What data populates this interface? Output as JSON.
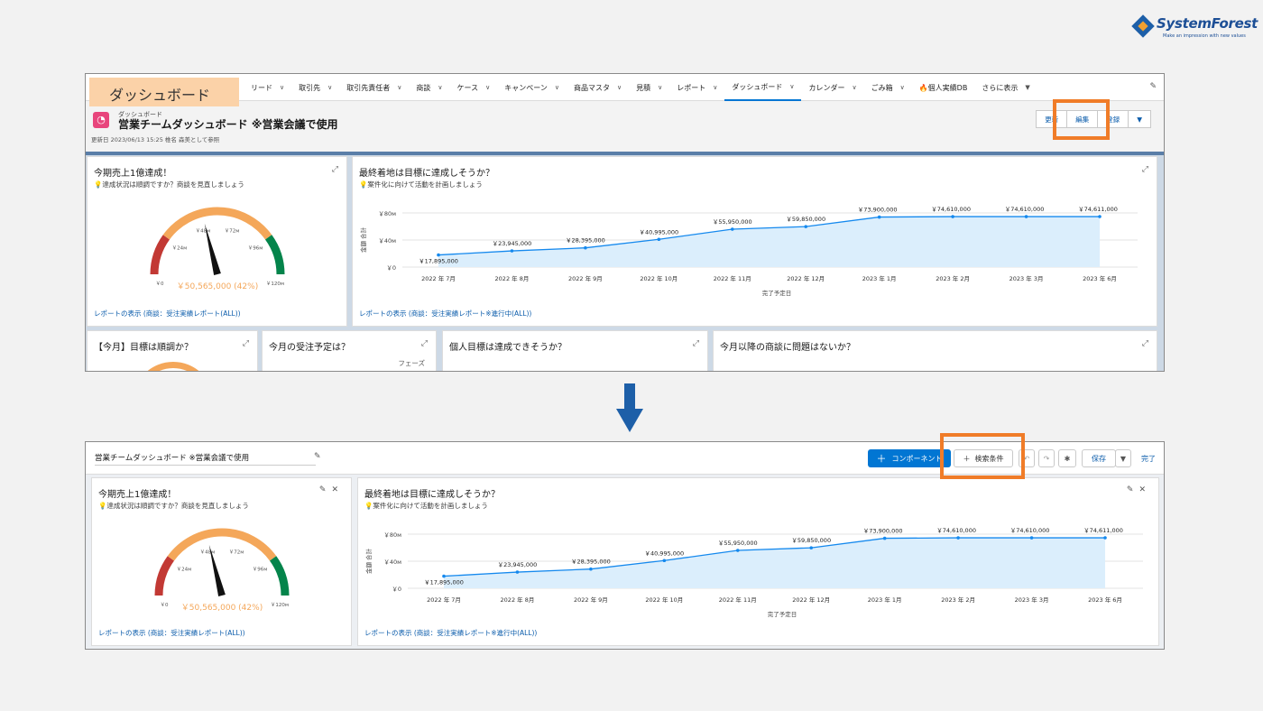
{
  "logo": {
    "name": "SystemForest",
    "tagline": "Make an impression with new values"
  },
  "top": {
    "badge": "ダッシュボード",
    "nav": [
      {
        "label": "リード"
      },
      {
        "label": "取引先"
      },
      {
        "label": "取引先責任者"
      },
      {
        "label": "商談"
      },
      {
        "label": "ケース"
      },
      {
        "label": "キャンペーン"
      },
      {
        "label": "商品マスタ"
      },
      {
        "label": "見積"
      },
      {
        "label": "レポート"
      },
      {
        "label": "ダッシュボード"
      },
      {
        "label": "カレンダー"
      },
      {
        "label": "ごみ箱"
      },
      {
        "label": "🔥個人実績DB"
      },
      {
        "label": "さらに表示"
      }
    ],
    "header": {
      "label": "ダッシュボード",
      "title": "営業チームダッシュボード ※営業会議で使用",
      "updated": "更新日 2023/06/13 15:25 椎名 森美として参照",
      "buttons": {
        "refresh": "更新",
        "edit": "編集",
        "subscribe": "登録"
      }
    },
    "cards": {
      "gauge_title": "今期売上1億達成！",
      "gauge_sub": "💡達成状況は順調ですか？商談を見直しましょう",
      "gauge_footer": "レポートの表示 (商談：受注実績レポート(ALL))",
      "line_title": "最終着地は目標に達成しそうか？",
      "line_sub": "💡案件化に向けて活動を計画しましょう",
      "line_footer": "レポートの表示 (商談：受注実績レポート※進行中(ALL))",
      "row2": [
        "【今月】目標は順調か？",
        "今月の受注予定は？",
        "個人目標は達成できそうか？",
        "今月以降の商談に問題はないか？"
      ],
      "phase": "フェーズ"
    }
  },
  "bottom": {
    "title": "営業チームダッシュボード ※営業会議で使用",
    "buttons": {
      "component": "コンポーネント",
      "filter": "検索条件",
      "save": "保存",
      "done": "完了"
    },
    "gauge_title": "今期売上1億達成！",
    "gauge_sub": "💡達成状況は順調ですか？商談を見直しましょう",
    "gauge_footer": "レポートの表示 (商談：受注実績レポート(ALL))",
    "line_title": "最終着地は目標に達成しそうか？",
    "line_sub": "💡案件化に向けて活動を計画しましょう",
    "line_footer": "レポートの表示 (商談：受注実績レポート※進行中(ALL))"
  },
  "chart_data": [
    {
      "type": "gauge",
      "value": 50565000,
      "value_label": "￥50,565,000 (42%)",
      "min": 0,
      "max": 120000000,
      "ticks": [
        "￥0",
        "￥24м",
        "￥48м",
        "￥72м",
        "￥96м",
        "￥120м"
      ],
      "bands": [
        {
          "from": 0,
          "to": 24000000,
          "color": "#c23934"
        },
        {
          "from": 24000000,
          "to": 96000000,
          "color": "#f4a75a"
        },
        {
          "from": 96000000,
          "to": 120000000,
          "color": "#04844b"
        }
      ]
    },
    {
      "type": "area",
      "x": [
        "2022 年 7月",
        "2022 年 8月",
        "2022 年 9月",
        "2022 年 10月",
        "2022 年 11月",
        "2022 年 12月",
        "2023 年 1月",
        "2023 年 2月",
        "2023 年 3月",
        "2023 年 6月"
      ],
      "values": [
        17895000,
        23945000,
        28395000,
        40995000,
        55950000,
        59850000,
        73900000,
        74610000,
        74610000,
        74611000
      ],
      "labels": [
        "￥17,895,000",
        "￥23,945,000",
        "￥28,395,000",
        "￥40,995,000",
        "￥55,950,000",
        "￥59,850,000",
        "￥73,900,000",
        "￥74,610,000",
        "￥74,610,000",
        "￥74,611,000"
      ],
      "yticks": [
        "￥0",
        "￥40м",
        "￥80м"
      ],
      "xlabel": "完了予定日",
      "ylabel": "金額 合計",
      "ylim": [
        0,
        80000000
      ],
      "colors": {
        "line": "#1589ee",
        "fill": "#dbeefc"
      }
    }
  ]
}
